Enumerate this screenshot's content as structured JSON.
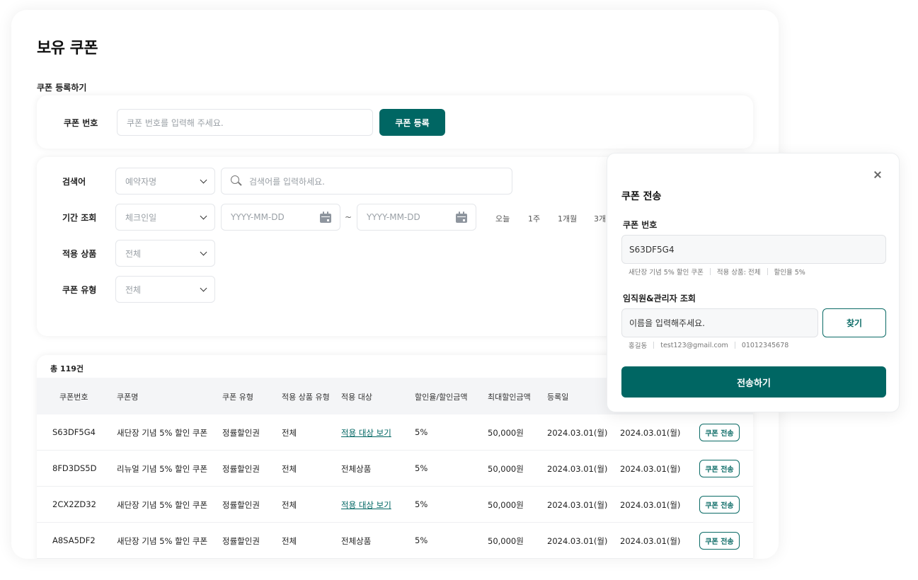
{
  "page": {
    "title": "보유 쿠폰",
    "register_section_label": "쿠폰 등록하기"
  },
  "register": {
    "label": "쿠폰 번호",
    "placeholder": "쿠폰 번호를 입력해 주세요.",
    "button": "쿠폰 등록"
  },
  "filters": {
    "keyword": {
      "label": "검색어",
      "select": "예약자명",
      "placeholder": "검색어를 입력하세요."
    },
    "period": {
      "label": "기간 조회",
      "select": "체크인일",
      "start_placeholder": "YYYY-MM-DD",
      "separator": "~",
      "end_placeholder": "YYYY-MM-DD",
      "quick": [
        "오늘",
        "1주",
        "1개월",
        "3개"
      ]
    },
    "product": {
      "label": "적용 상품",
      "select": "전체"
    },
    "coupon_type": {
      "label": "쿠폰 유형",
      "select": "전체"
    }
  },
  "table": {
    "total": "총 119건",
    "columns": [
      "쿠폰번호",
      "쿠폰명",
      "쿠폰 유형",
      "적용 상품 유형",
      "적용 대상",
      "할인율/할인금액",
      "최대할인금액",
      "등록일"
    ],
    "rows": [
      {
        "code": "S63DF5G4",
        "name": "새단장 기념 5% 할인 쿠폰",
        "type": "정률할인권",
        "product_type": "전체",
        "target": "적용 대상 보기",
        "target_link": true,
        "rate": "5%",
        "max": "50,000원",
        "registered": "2024.03.01(월)",
        "expires": "2024.03.01(월)",
        "action": "쿠폰 전송"
      },
      {
        "code": "8FD3DS5D",
        "name": "리뉴얼 기념 5% 할인 쿠폰",
        "type": "정률할인권",
        "product_type": "전체",
        "target": "전체상품",
        "target_link": false,
        "rate": "5%",
        "max": "50,000원",
        "registered": "2024.03.01(월)",
        "expires": "2024.03.01(월)",
        "action": "쿠폰 전송"
      },
      {
        "code": "2CX2ZD32",
        "name": "새단장 기념 5% 할인 쿠폰",
        "type": "정률할인권",
        "product_type": "전체",
        "target": "적용 대상 보기",
        "target_link": true,
        "rate": "5%",
        "max": "50,000원",
        "registered": "2024.03.01(월)",
        "expires": "2024.03.01(월)",
        "action": "쿠폰 전송"
      },
      {
        "code": "A8SA5DF2",
        "name": "새단장 기념 5% 할인 쿠폰",
        "type": "정률할인권",
        "product_type": "전체",
        "target": "전체상품",
        "target_link": false,
        "rate": "5%",
        "max": "50,000원",
        "registered": "2024.03.01(월)",
        "expires": "2024.03.01(월)",
        "action": "쿠폰 전송"
      }
    ]
  },
  "modal": {
    "title": "쿠폰 전송",
    "coupon_label": "쿠폰 번호",
    "coupon_value": "S63DF5G4",
    "coupon_meta": [
      "새단장 기념 5% 할인 쿠폰",
      "적용 상품: 전체",
      "할인율 5%"
    ],
    "search_label": "임직원&관리자 조회",
    "search_placeholder": "이름을 입력해주세요.",
    "find_button": "찾기",
    "user_meta": [
      "홍길동",
      "test123@gmail.com",
      "01012345678"
    ],
    "send_button": "전송하기"
  },
  "colors": {
    "primary": "#006663",
    "link": "#006663",
    "header_bg": "#f4f5f7"
  }
}
